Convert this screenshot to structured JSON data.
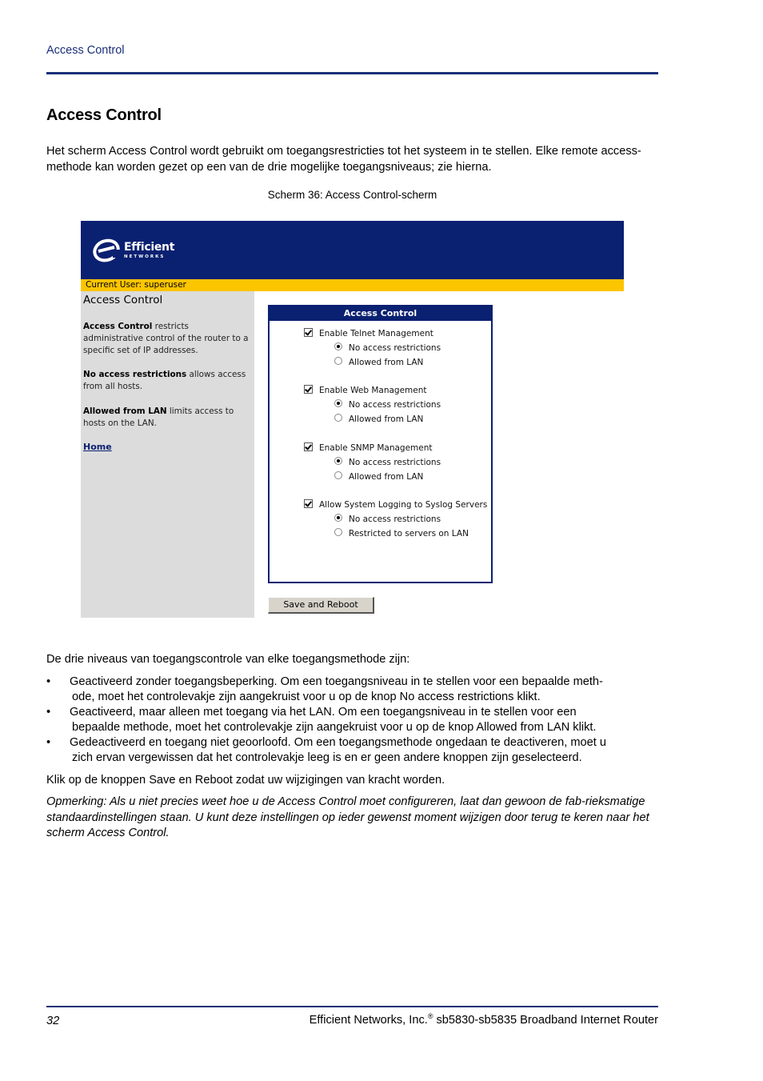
{
  "header": {
    "running_head": "Access Control"
  },
  "section": {
    "title": "Access Control",
    "intro": "Het scherm Access Control wordt gebruikt om toegangsrestricties tot het systeem in te stellen. Elke remote access-methode kan worden gezet op een van de drie mogelijke toegangsniveaus; zie hierna.",
    "figure_caption": "Scherm 36: Access Control-scherm"
  },
  "screenshot": {
    "logo": {
      "word": "Efficient",
      "sub": "NETWORKS"
    },
    "current_user_label": "Current User: superuser",
    "sidebar": {
      "title": "Access Control",
      "paragraphs": [
        {
          "bold": "Access Control",
          "rest": " restricts administrative control of the router to a specific set of IP addresses."
        },
        {
          "bold": "No access restrictions",
          "rest": " allows access from all hosts."
        },
        {
          "bold": "Allowed from LAN",
          "rest": " limits access to hosts on the LAN."
        }
      ],
      "home_link": "Home"
    },
    "panel": {
      "title": "Access Control",
      "groups": [
        {
          "label": "Enable Telnet Management",
          "checked": true,
          "options": [
            "No access restrictions",
            "Allowed from LAN"
          ],
          "selected": 0
        },
        {
          "label": "Enable Web Management",
          "checked": true,
          "options": [
            "No access restrictions",
            "Allowed from LAN"
          ],
          "selected": 0
        },
        {
          "label": "Enable SNMP Management",
          "checked": true,
          "options": [
            "No access restrictions",
            "Allowed from LAN"
          ],
          "selected": 0
        },
        {
          "label": "Allow System Logging to Syslog Servers",
          "checked": true,
          "options": [
            "No access restrictions",
            "Restricted to servers on LAN"
          ],
          "selected": 0
        }
      ]
    },
    "save_button": "Save and Reboot"
  },
  "content": {
    "levels_intro": "De drie niveaus van toegangscontrole van elke toegangsmethode zijn:",
    "bullets": [
      {
        "line1": "Geactiveerd zonder toegangsbeperking. Om een toegangsniveau in te stellen voor een bepaalde meth-",
        "line2": "ode, moet het controlevakje zijn aangekruist voor u op de knop No access restrictions klikt."
      },
      {
        "line1": "Geactiveerd, maar alleen met toegang via het LAN. Om een toegangsniveau in te stellen voor een",
        "line2": "bepaalde methode, moet het controlevakje zijn aangekruist voor u op de knop Allowed from LAN klikt."
      },
      {
        "line1": "Gedeactiveerd en toegang niet geoorloofd. Om een toegangsmethode ongedaan te deactiveren, moet u",
        "line2": "zich ervan vergewissen dat het controlevakje leeg is en er geen andere knoppen zijn geselecteerd."
      }
    ],
    "bullet_symbol": "•",
    "save_instruction": "Klik op de knoppen Save en Reboot zodat uw wijzigingen van kracht worden.",
    "note": "Opmerking: Als u niet precies weet hoe u de Access Control moet configureren, laat dan gewoon de fab-rieksmatige standaardinstellingen staan. U kunt deze instellingen op ieder gewenst moment wijzigen door terug te keren naar het scherm Access Control."
  },
  "footer": {
    "page_number": "32",
    "company": "Efficient Networks, Inc.",
    "registered": "®",
    "product": " sb5830-sb5835 Broadband Internet Router"
  }
}
